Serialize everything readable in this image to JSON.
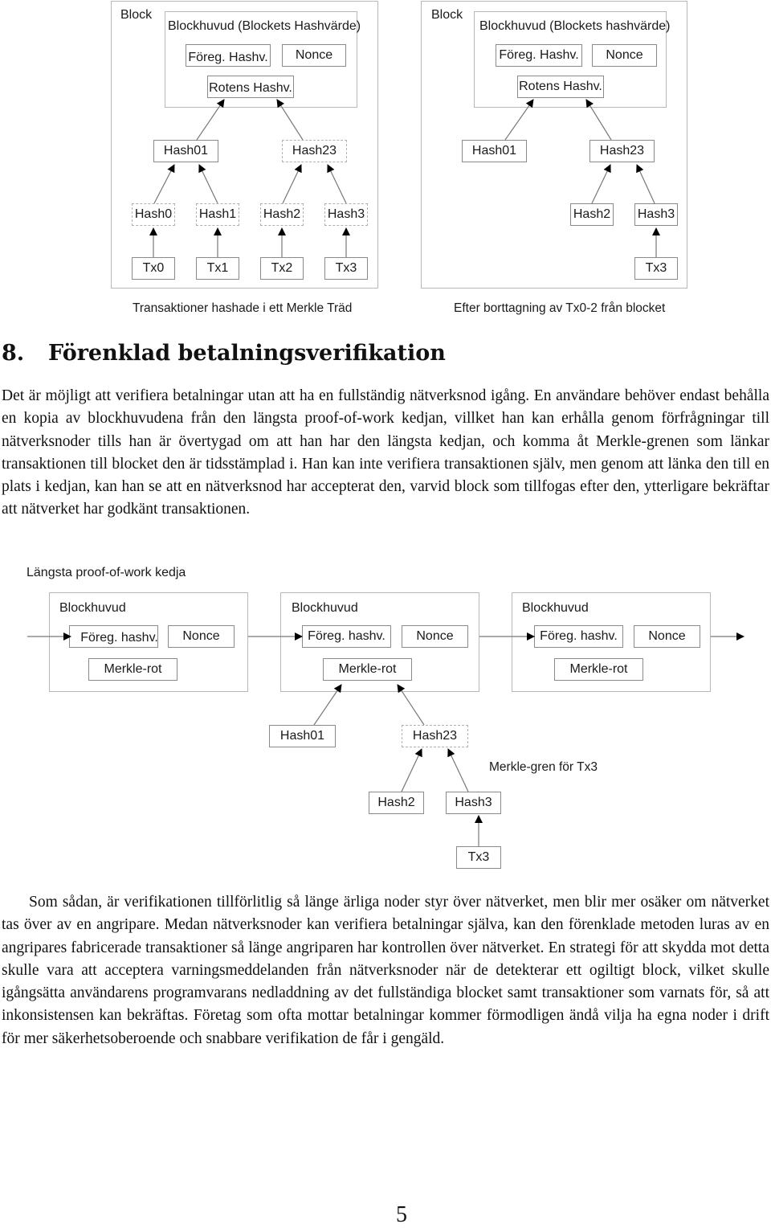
{
  "figure1": {
    "left": {
      "block_label": "Block",
      "header_label": "Blockhuvud (Blockets Hashvärde)",
      "prev_hash": "Föreg. Hashv.",
      "nonce": "Nonce",
      "root_hash": "Rotens Hashv.",
      "level1": [
        "Hash01",
        "Hash23"
      ],
      "level2": [
        "Hash0",
        "Hash1",
        "Hash2",
        "Hash3"
      ],
      "transactions": [
        "Tx0",
        "Tx1",
        "Tx2",
        "Tx3"
      ],
      "caption": "Transaktioner hashade i ett Merkle Träd"
    },
    "right": {
      "block_label": "Block",
      "header_label": "Blockhuvud (Blockets hashvärde)",
      "prev_hash": "Föreg. Hashv.",
      "nonce": "Nonce",
      "root_hash": "Rotens Hashv.",
      "level1": [
        "Hash01",
        "Hash23"
      ],
      "level2": [
        "Hash2",
        "Hash3"
      ],
      "transactions": [
        "Tx3"
      ],
      "caption": "Efter borttagning av Tx0-2 från blocket"
    }
  },
  "section": {
    "number": "8.",
    "title": "Förenklad betalningsverifikation"
  },
  "paragraph1": "Det är möjligt att verifiera betalningar utan att ha en fullständig nätverksnod igång. En användare behöver endast behålla en kopia av blockhuvudena från den längsta proof-of-work kedjan, villket han kan erhålla genom förfrågningar till nätverksnoder tills han är övertygad om att han har den längsta kedjan, och komma åt Merkle-grenen som länkar transaktionen till blocket den är tidsstämplad i. Han kan inte verifiera transaktionen själv, men genom att länka den till en plats i kedjan, kan han se att en nätverksnod har accepterat den, varvid block som tillfogas efter den, ytterligare bekräftar att nätverket har godkänt transaktionen.",
  "figure2": {
    "title": "Längsta proof-of-work kedja",
    "blocks": [
      {
        "header": "Blockhuvud",
        "prev_hash": "Föreg. hashv.",
        "nonce": "Nonce",
        "merkle_root": "Merkle-rot"
      },
      {
        "header": "Blockhuvud",
        "prev_hash": "Föreg. hashv.",
        "nonce": "Nonce",
        "merkle_root": "Merkle-rot"
      },
      {
        "header": "Blockhuvud",
        "prev_hash": "Föreg. hashv.",
        "nonce": "Nonce",
        "merkle_root": "Merkle-rot"
      }
    ],
    "branch": {
      "level1": [
        "Hash01",
        "Hash23"
      ],
      "level2": [
        "Hash2",
        "Hash3"
      ],
      "transaction": "Tx3",
      "label": "Merkle-gren för Tx3"
    }
  },
  "paragraph2": "Som sådan, är verifikationen tillförlitlig så länge ärliga noder styr över nätverket, men blir mer osäker om nätverket tas över av en angripare. Medan nätverksnoder kan verifiera betalningar själva, kan den förenklade metoden luras av en angripares fabricerade transaktioner så länge angriparen har kontrollen över nätverket. En strategi för att skydda mot detta skulle vara att acceptera varningsmeddelanden från nätverksnoder när de detekterar ett ogiltigt block, vilket skulle igångsätta användarens programvarans nedladdning av det fullständiga blocket samt transaktioner som varnats för, så att inkonsistensen kan bekräftas. Företag som ofta mottar betalningar  kommer förmodligen ändå vilja ha egna noder i drift för mer säkerhetsoberoende och snabbare verifikation de får i gengäld.",
  "page_number": "5"
}
